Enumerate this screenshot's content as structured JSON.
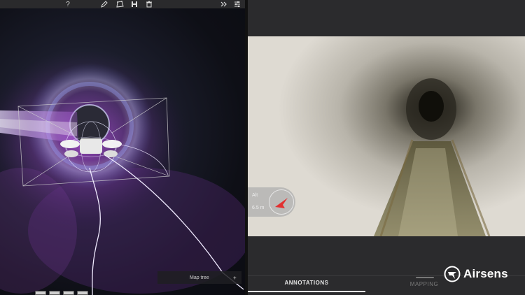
{
  "toolbar": {
    "help_label": "?",
    "icons": [
      "pencil-icon",
      "polygon-icon",
      "save-icon",
      "trash-icon",
      "double-chevron-right-icon",
      "sliders-icon"
    ]
  },
  "map_tree": {
    "label": "Map tree",
    "add_label": "+"
  },
  "hud": {
    "altitude_label": "Alt",
    "distance_label": "6.5 m"
  },
  "tabs": [
    {
      "label": "ANNOTATIONS",
      "active": true
    },
    {
      "label": "MAPPING",
      "active": false
    }
  ],
  "brand": {
    "name": "Airsens"
  },
  "colors": {
    "accent": "#e23030",
    "point_cloud": "#8a3fb0",
    "trail": "#c9c4ff"
  }
}
